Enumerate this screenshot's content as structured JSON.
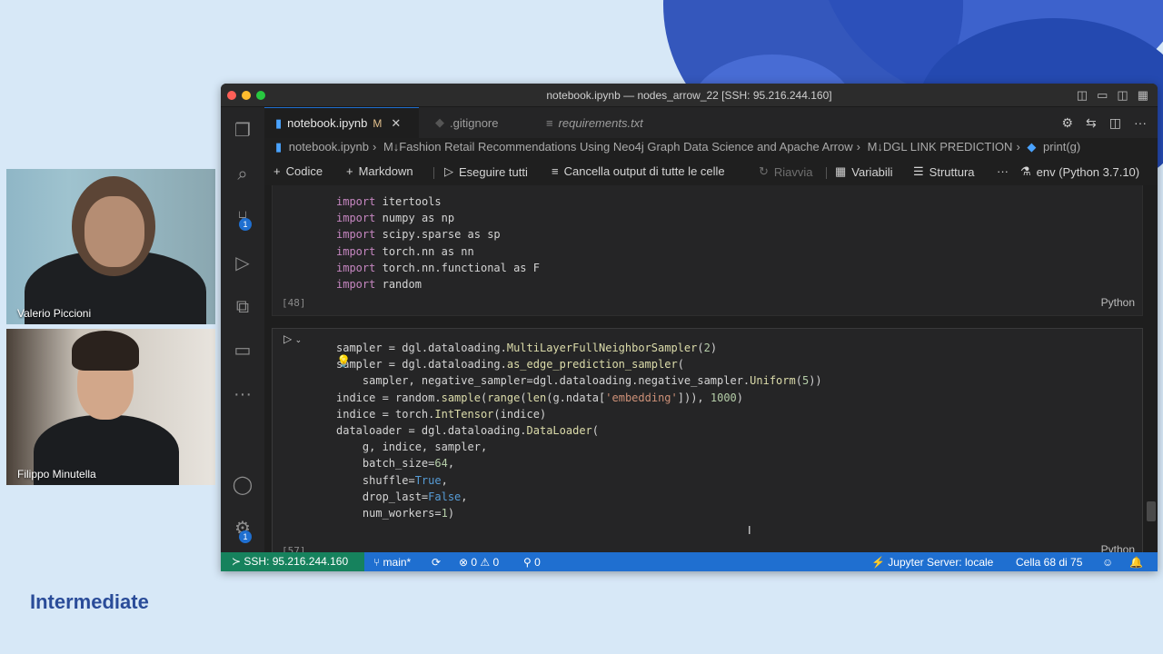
{
  "background": {
    "accent": "#2b4fb8"
  },
  "participants": [
    {
      "name": "Valerio Piccioni"
    },
    {
      "name": "Filippo Minutella"
    }
  ],
  "level_label": "Intermediate",
  "window": {
    "title": "notebook.ipynb — nodes_arrow_22 [SSH: 95.216.244.160]",
    "tabs": [
      {
        "label": "notebook.ipynb",
        "modified": "M",
        "active": true
      },
      {
        "label": ".gitignore",
        "active": false
      },
      {
        "label": "requirements.txt",
        "active": false
      }
    ],
    "breadcrumbs": [
      "notebook.ipynb",
      "M↓Fashion Retail Recommendations Using Neo4j Graph Data Science and Apache Arrow",
      "M↓DGL LINK PREDICTION",
      "print(g)"
    ],
    "toolbar": {
      "code": "Codice",
      "markdown": "Markdown",
      "run_all": "Eseguire tutti",
      "clear": "Cancella output di tutte le celle",
      "restart": "Riavvia",
      "variables": "Variabili",
      "outline": "Struttura",
      "more": "···",
      "kernel": "env (Python 3.7.10)"
    },
    "activity_badges": {
      "source_control": "1",
      "settings": "1"
    },
    "cell1": {
      "exec_count": "[48]",
      "language": "Python",
      "lines": [
        [
          "import",
          "itertools"
        ],
        [
          "import",
          "numpy as np"
        ],
        [
          "import",
          "scipy.sparse as sp"
        ],
        [
          "import",
          "torch.nn as nn"
        ],
        [
          "import",
          "torch.nn.functional as F"
        ],
        [
          "import",
          "random"
        ]
      ]
    },
    "cell2": {
      "exec_count": "[57]",
      "language": "Python",
      "code": [
        "sampler = dgl.dataloading.MultiLayerFullNeighborSampler(2)",
        "sampler = dgl.dataloading.as_edge_prediction_sampler(",
        "    sampler, negative_sampler=dgl.dataloading.negative_sampler.Uniform(5))",
        "indice = random.sample(range(len(g.ndata['embedding'])), 1000)",
        "indice = torch.IntTensor(indice)",
        "dataloader = dgl.dataloading.DataLoader(",
        "    g, indice, sampler,",
        "    batch_size=64,",
        "    shuffle=True,",
        "    drop_last=False,",
        "    num_workers=1)"
      ]
    },
    "status": {
      "remote": "SSH: 95.216.244.160",
      "branch": "main*",
      "errors": "0",
      "warnings": "0",
      "ports": "0",
      "jupyter": "Jupyter Server: locale",
      "cell_pos": "Cella 68 di 75"
    }
  }
}
